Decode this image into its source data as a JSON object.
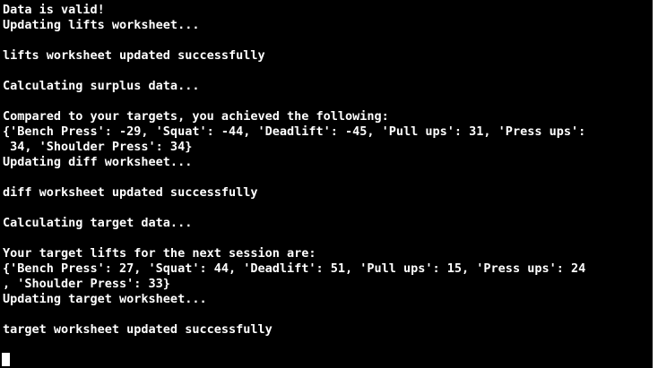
{
  "terminal": {
    "lines": [
      "Data is valid!",
      "Updating lifts worksheet...",
      "",
      "lifts worksheet updated successfully",
      "",
      "Calculating surplus data...",
      "",
      "Compared to your targets, you achieved the following:",
      "{'Bench Press': -29, 'Squat': -44, 'Deadlift': -45, 'Pull ups': 31, 'Press ups':",
      " 34, 'Shoulder Press': 34}",
      "Updating diff worksheet...",
      "",
      "diff worksheet updated successfully",
      "",
      "Calculating target data...",
      "",
      "Your target lifts for the next session are:",
      "{'Bench Press': 27, 'Squat': 44, 'Deadlift': 51, 'Pull ups': 15, 'Press ups': 24",
      ", 'Shoulder Press': 33}",
      "Updating target worksheet...",
      "",
      "target worksheet updated successfully"
    ],
    "colors": {
      "background": "#000000",
      "foreground": "#ffffff"
    }
  }
}
